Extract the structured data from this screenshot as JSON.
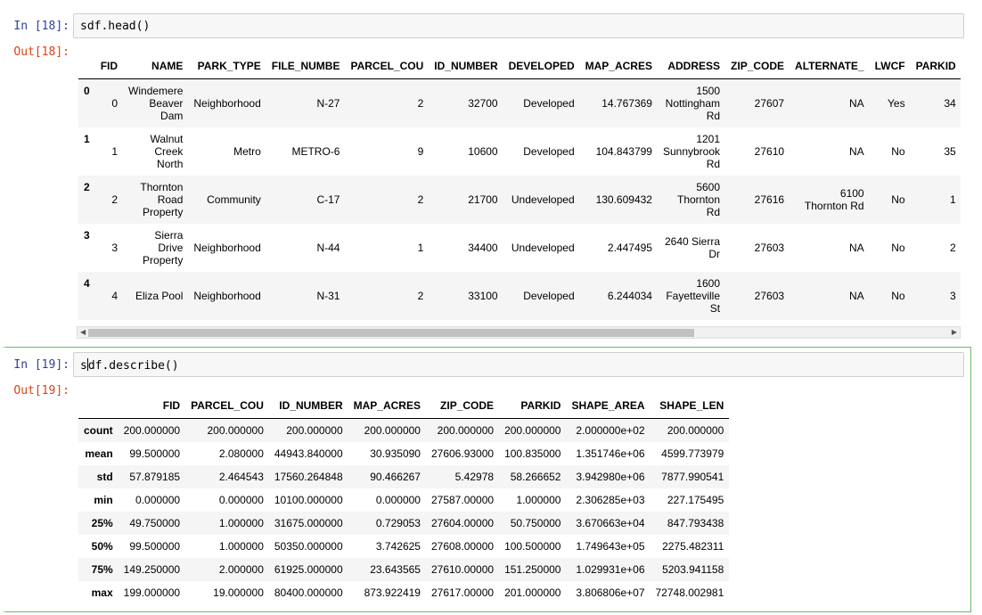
{
  "cell18": {
    "in_prompt": "In [18]:",
    "code": "sdf.head()",
    "out_prompt": "Out[18]:",
    "columns": [
      "",
      "FID",
      "NAME",
      "PARK_TYPE",
      "FILE_NUMBE",
      "PARCEL_COU",
      "ID_NUMBER",
      "DEVELOPED",
      "MAP_ACRES",
      "ADDRESS",
      "ZIP_CODE",
      "ALTERNATE_",
      "LWCF",
      "PARKID"
    ],
    "rows": [
      {
        "index": "0",
        "cells": [
          "0",
          "Windemere\nBeaver\nDam",
          "Neighborhood",
          "N-27",
          "2",
          "32700",
          "Developed",
          "14.767369",
          "1500\nNottingham\nRd",
          "27607",
          "NA",
          "Yes",
          "34"
        ]
      },
      {
        "index": "1",
        "cells": [
          "1",
          "Walnut\nCreek\nNorth",
          "Metro",
          "METRO-6",
          "9",
          "10600",
          "Developed",
          "104.843799",
          "1201\nSunnybrook\nRd",
          "27610",
          "NA",
          "No",
          "35"
        ]
      },
      {
        "index": "2",
        "cells": [
          "2",
          "Thornton\nRoad\nProperty",
          "Community",
          "C-17",
          "2",
          "21700",
          "Undeveloped",
          "130.609432",
          "5600\nThornton\nRd",
          "27616",
          "6100\nThornton Rd",
          "No",
          "1"
        ]
      },
      {
        "index": "3",
        "cells": [
          "3",
          "Sierra\nDrive\nProperty",
          "Neighborhood",
          "N-44",
          "1",
          "34400",
          "Undeveloped",
          "2.447495",
          "2640 Sierra\nDr",
          "27603",
          "NA",
          "No",
          "2"
        ]
      },
      {
        "index": "4",
        "cells": [
          "4",
          "Eliza Pool",
          "Neighborhood",
          "N-31",
          "2",
          "33100",
          "Developed",
          "6.244034",
          "1600\nFayetteville\nSt",
          "27603",
          "NA",
          "No",
          "3"
        ]
      }
    ]
  },
  "cell19": {
    "in_prompt": "In [19]:",
    "code_before_cursor": "s",
    "code_after_cursor": "df.describe()",
    "out_prompt": "Out[19]:",
    "columns": [
      "",
      "FID",
      "PARCEL_COU",
      "ID_NUMBER",
      "MAP_ACRES",
      "ZIP_CODE",
      "PARKID",
      "SHAPE_AREA",
      "SHAPE_LEN"
    ],
    "rows": [
      {
        "index": "count",
        "cells": [
          "200.000000",
          "200.000000",
          "200.000000",
          "200.000000",
          "200.000000",
          "200.000000",
          "2.000000e+02",
          "200.000000"
        ]
      },
      {
        "index": "mean",
        "cells": [
          "99.500000",
          "2.080000",
          "44943.840000",
          "30.935090",
          "27606.93000",
          "100.835000",
          "1.351746e+06",
          "4599.773979"
        ]
      },
      {
        "index": "std",
        "cells": [
          "57.879185",
          "2.464543",
          "17560.264848",
          "90.466267",
          "5.42978",
          "58.266652",
          "3.942980e+06",
          "7877.990541"
        ]
      },
      {
        "index": "min",
        "cells": [
          "0.000000",
          "0.000000",
          "10100.000000",
          "0.000000",
          "27587.00000",
          "1.000000",
          "2.306285e+03",
          "227.175495"
        ]
      },
      {
        "index": "25%",
        "cells": [
          "49.750000",
          "1.000000",
          "31675.000000",
          "0.729053",
          "27604.00000",
          "50.750000",
          "3.670663e+04",
          "847.793438"
        ]
      },
      {
        "index": "50%",
        "cells": [
          "99.500000",
          "1.000000",
          "50350.000000",
          "3.742625",
          "27608.00000",
          "100.500000",
          "1.749643e+05",
          "2275.482311"
        ]
      },
      {
        "index": "75%",
        "cells": [
          "149.250000",
          "2.000000",
          "61925.000000",
          "23.643565",
          "27610.00000",
          "151.250000",
          "1.029931e+06",
          "5203.941158"
        ]
      },
      {
        "index": "max",
        "cells": [
          "199.000000",
          "19.000000",
          "80400.000000",
          "873.922419",
          "27617.00000",
          "201.000000",
          "3.806806e+07",
          "72748.002981"
        ]
      }
    ]
  },
  "scrollbar": {
    "left_arrow": "◀",
    "right_arrow": "▶"
  }
}
